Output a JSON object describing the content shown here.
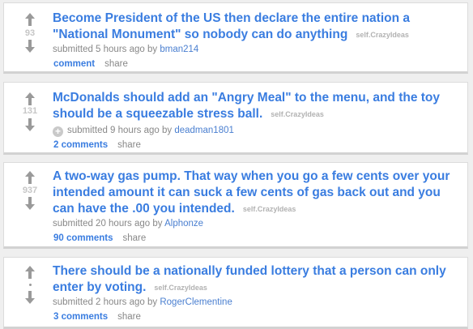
{
  "colors": {
    "background": "#efefef",
    "link": "#3a7de0",
    "author": "#4a7fd0",
    "meta": "#888888",
    "domain": "#b2b2b2",
    "arrow": "#9a9a9a"
  },
  "icons": {
    "upvote": "upvote-arrow-icon",
    "downvote": "downvote-arrow-icon",
    "expand": "expand-plus-icon"
  },
  "posts": [
    {
      "score": "93",
      "title": "Become President of the US then declare the entire nation a \"National Monument\" so nobody can do anything",
      "domain": "self.CrazyIdeas",
      "submitted": "submitted 5 hours ago by",
      "author": "bman214",
      "comments": "comment",
      "share": "share"
    },
    {
      "score": "131",
      "title": "McDonalds should add an \"Angry Meal\" to the menu, and the toy should be a squeezable stress ball.",
      "domain": "self.CrazyIdeas",
      "expando": "+",
      "submitted": "submitted 9 hours ago by",
      "author": "deadman1801",
      "comments": "2 comments",
      "share": "share"
    },
    {
      "score": "937",
      "title": "A two-way gas pump. That way when you go a few cents over your intended amount it can suck a few cents of gas back out and you can have the .00 you intended.",
      "domain": "self.CrazyIdeas",
      "submitted": "submitted 20 hours ago by",
      "author": "Alphonze",
      "comments": "90 comments",
      "share": "share"
    },
    {
      "score": "",
      "title": "There should be a nationally funded lottery that a person can only enter by voting.",
      "domain": "self.CrazyIdeas",
      "submitted": "submitted 2 hours ago by",
      "author": "RogerClementine",
      "comments": "3 comments",
      "share": "share"
    }
  ]
}
